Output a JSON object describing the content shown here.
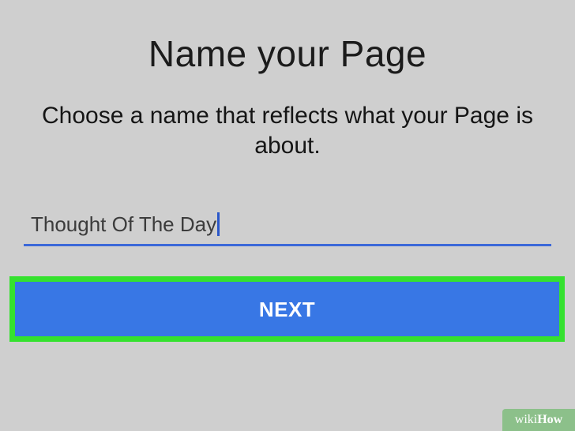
{
  "header": {
    "title": "Name your Page",
    "subtitle": "Choose a name that reflects what your Page is about."
  },
  "form": {
    "page_name_value": "Thought Of The Day"
  },
  "actions": {
    "next_label": "NEXT"
  },
  "watermark": {
    "wiki": "wiki",
    "how": "How"
  },
  "colors": {
    "background": "#cfcfcf",
    "accent": "#3877e5",
    "underline": "#3b68d8",
    "highlight": "#35e12f"
  }
}
